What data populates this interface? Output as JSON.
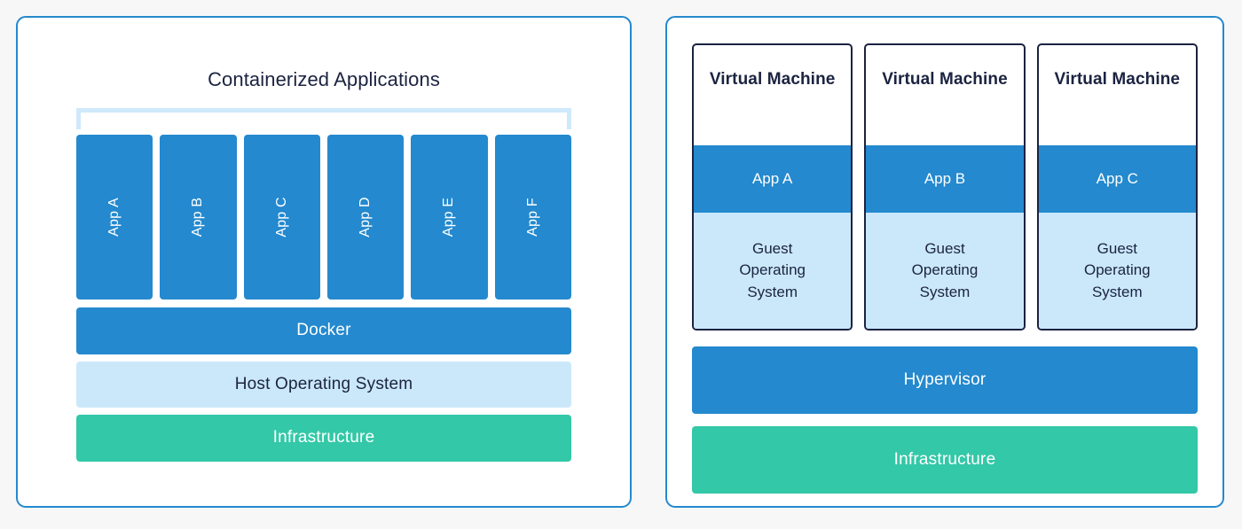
{
  "colors": {
    "page_background": "#f7f7f8",
    "panel_border": "#2489ce",
    "accent_blue": "#2489ce",
    "light_blue": "#cbe8fa",
    "bracket_blue": "#cfe9fb",
    "green": "#33c8a7",
    "dark_navy": "#1b2340",
    "white": "#ffffff"
  },
  "left_panel": {
    "title": "Containerized Applications",
    "apps": [
      {
        "label": "App A"
      },
      {
        "label": "App B"
      },
      {
        "label": "App C"
      },
      {
        "label": "App D"
      },
      {
        "label": "App E"
      },
      {
        "label": "App F"
      }
    ],
    "layers": [
      {
        "label": "Docker",
        "style": "blue"
      },
      {
        "label": "Host Operating System",
        "style": "light"
      },
      {
        "label": "Infrastructure",
        "style": "green"
      }
    ],
    "docker_label": "Docker",
    "host_os_label": "Host Operating System",
    "infrastructure_label": "Infrastructure"
  },
  "right_panel": {
    "vms": [
      {
        "title": "Virtual Machine",
        "app": "App A",
        "guest_os_line1": "Guest",
        "guest_os_line2": "Operating",
        "guest_os_line3": "System"
      },
      {
        "title": "Virtual Machine",
        "app": "App B",
        "guest_os_line1": "Guest",
        "guest_os_line2": "Operating",
        "guest_os_line3": "System"
      },
      {
        "title": "Virtual Machine",
        "app": "App C",
        "guest_os_line1": "Guest",
        "guest_os_line2": "Operating",
        "guest_os_line3": "System"
      }
    ],
    "hypervisor_label": "Hypervisor",
    "infrastructure_label": "Infrastructure"
  }
}
